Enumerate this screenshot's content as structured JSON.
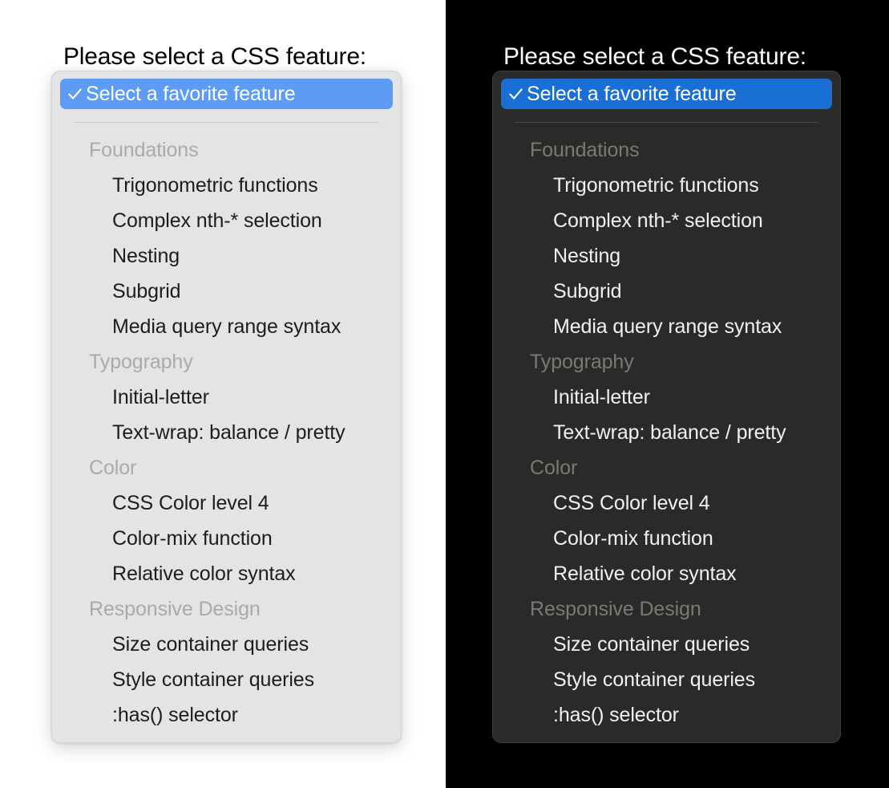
{
  "panes": [
    {
      "theme": "light",
      "prompt": "Please select a CSS feature:",
      "accent": "#5c9cf5",
      "panel_bg": "#e3e4e6",
      "text_color": "#1d1d1f",
      "group_color": "#a9aaac"
    },
    {
      "theme": "dark",
      "prompt": "Please select a CSS feature:",
      "accent": "#1a6fd4",
      "panel_bg": "#2b2a28",
      "text_color": "#f2f1ef",
      "group_color": "#7a7975"
    }
  ],
  "menu": {
    "selected": {
      "label": "Select a favorite feature",
      "icon": "check-icon",
      "checked": true
    },
    "groups": [
      {
        "label": "Foundations",
        "options": [
          "Trigonometric functions",
          "Complex nth-* selection",
          "Nesting",
          "Subgrid",
          "Media query range syntax"
        ]
      },
      {
        "label": "Typography",
        "options": [
          "Initial-letter",
          "Text-wrap: balance / pretty"
        ]
      },
      {
        "label": "Color",
        "options": [
          "CSS Color level 4",
          "Color-mix function",
          "Relative color syntax"
        ]
      },
      {
        "label": "Responsive Design",
        "options": [
          "Size container queries",
          "Style container queries",
          ":has() selector"
        ]
      }
    ]
  }
}
